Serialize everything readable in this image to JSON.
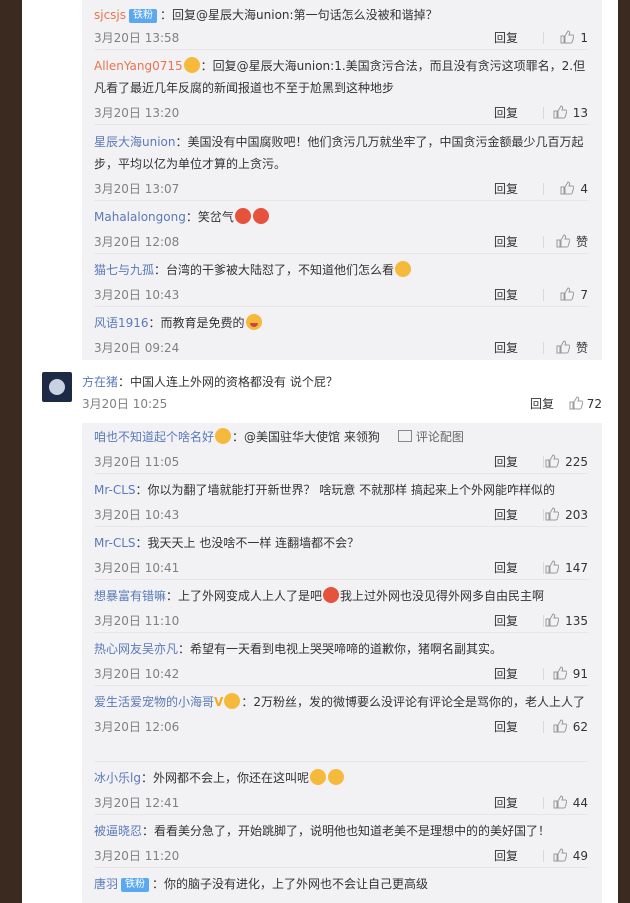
{
  "comments_top": [
    {
      "user": "sjcsjs",
      "badge": "铁粉",
      "text": "：回复@星辰大海union:第一句话怎么没被和谐掉？",
      "time": "3月20日 13:58",
      "reply": "回复",
      "likes": "1"
    },
    {
      "user": "AllenYang0715",
      "text": "：回复@星辰大海union:1.美国贪污合法，而且没有贪污这项罪名，2.但凡看了最近几年反腐的新闻报道也不至于尬黑到这种地步",
      "time": "3月20日 13:20",
      "reply": "回复",
      "likes": "13"
    },
    {
      "user": "星辰大海union",
      "text": "：美国没有中国腐败吧！他们贪污几万就坐牢了，中国贪污金额最少几百万起步，平均以亿为单位才算的上贪污。",
      "time": "3月20日 13:07",
      "reply": "回复",
      "likes": "4"
    },
    {
      "user": "Mahalalongong",
      "text": "：笑岔气",
      "time": "3月20日 12:08",
      "reply": "回复",
      "likes": "赞"
    },
    {
      "user": "猫七与九孤",
      "text": "：台湾的干爹被大陆怼了，不知道他们怎么看",
      "time": "3月20日 10:43",
      "reply": "回复",
      "likes": "7"
    },
    {
      "user": "风语1916",
      "text": "：而教育是免费的",
      "time": "3月20日 09:24",
      "reply": "回复",
      "likes": "赞"
    }
  ],
  "main_comment": {
    "user": "方在猪",
    "text": "：中国人连上外网的资格都没有 说个屁？",
    "time": "3月20日 10:25",
    "reply": "回复",
    "likes": "72"
  },
  "comments_bottom": [
    {
      "user": "咱也不知道起个啥名好",
      "text": "：@美国驻华大使馆 来领狗",
      "pic_label": "评论配图",
      "time": "3月20日 11:05",
      "reply": "回复",
      "likes": "225"
    },
    {
      "user": "Mr-CLS",
      "text": "：你以为翻了墙就能打开新世界？ 啥玩意 不就那样 搞起来上个外网能咋样似的",
      "time": "3月20日 10:43",
      "reply": "回复",
      "likes": "203"
    },
    {
      "user": "Mr-CLS",
      "text": "：我天天上 也没啥不一样 连翻墙都不会？",
      "time": "3月20日 10:41",
      "reply": "回复",
      "likes": "147"
    },
    {
      "user": "想暴富有错嘛",
      "text": "：上了外网变成人上人了是吧",
      "text2": "我上过外网也没见得外网多自由民主啊",
      "time": "3月20日 11:10",
      "reply": "回复",
      "likes": "135"
    },
    {
      "user": "热心网友吴亦凡",
      "text": "：希望有一天看到电视上哭哭啼啼的道歉你，猪啊名副其实。",
      "time": "3月20日 10:42",
      "reply": "回复",
      "likes": "91"
    },
    {
      "user": "爱生活爱宠物的小海哥",
      "text": "：2万粉丝，发的微博要么没评论有评论全是骂你的，老人上人了",
      "time": "3月20日 12:06",
      "reply": "回复",
      "likes": "62"
    },
    {
      "user": "冰小乐lg",
      "text": "：外网都不会上，你还在这叫呢",
      "time": "3月20日 12:41",
      "reply": "回复",
      "likes": "44"
    },
    {
      "user": "被逼晓忍",
      "text": "：看看美分急了，开始跳脚了，说明他也知道老美不是理想中的的美好国了！",
      "time": "3月20日 11:20",
      "reply": "回复",
      "likes": "49"
    },
    {
      "user": "唐羽",
      "badge": "铁粉",
      "text": "：你的脑子没有进化，上了外网也不会让自己更高级"
    }
  ]
}
